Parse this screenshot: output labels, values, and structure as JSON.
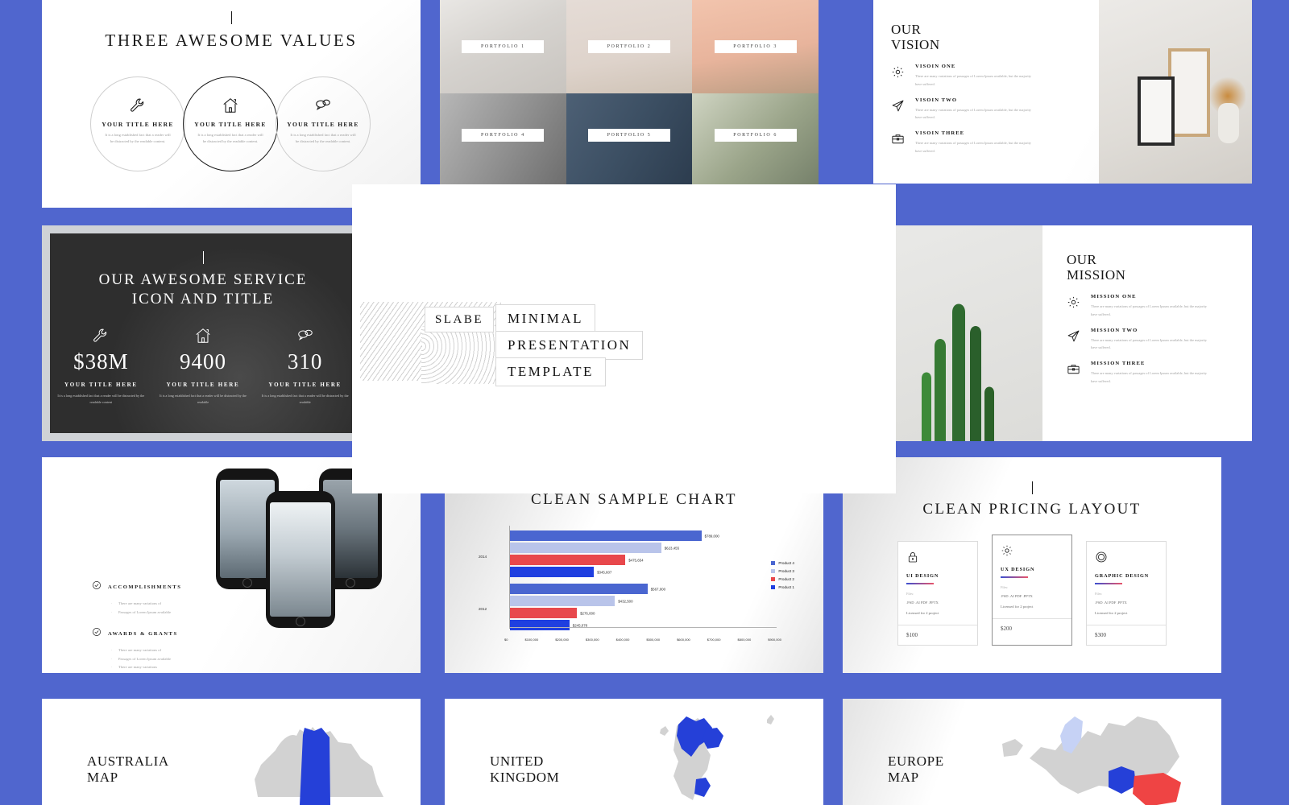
{
  "theme": {
    "background": "#5066ce",
    "accent_blue": "#2540d8",
    "accent_red": "#ef4444"
  },
  "overlay": {
    "brand": "SLABE",
    "line1": "MINIMAL",
    "line2": "PRESENTATION",
    "line3": "TEMPLATE"
  },
  "slide_values": {
    "title": "THREE AWESOME VALUES",
    "cards": [
      {
        "icon": "wrench-icon",
        "title": "YOUR TITLE HERE",
        "desc": "It is a long established fact that a reader will be distracted by the readable content."
      },
      {
        "icon": "home-icon",
        "title": "YOUR TITLE HERE",
        "desc": "It is a long established fact that a reader will be distracted by the readable content."
      },
      {
        "icon": "chat-icon",
        "title": "YOUR TITLE HERE",
        "desc": "It is a long established fact that a reader will be distracted by the readable content."
      }
    ]
  },
  "slide_portfolio": {
    "items": [
      {
        "caption": "PORTFOLIO 1"
      },
      {
        "caption": "PORTFOLIO 2"
      },
      {
        "caption": "PORTFOLIO 3"
      },
      {
        "caption": "PORTFOLIO 4"
      },
      {
        "caption": "PORTFOLIO 5"
      },
      {
        "caption": "PORTFOLIO 6"
      }
    ]
  },
  "slide_vision": {
    "title_line1": "OUR",
    "title_line2": "VISION",
    "items": [
      {
        "icon": "gear-icon",
        "heading": "VISOIN ONE",
        "desc": "There are many variations of passages of Lorem Ipsum available, but the majority have suffered."
      },
      {
        "icon": "paper-plane-icon",
        "heading": "VISOIN TWO",
        "desc": "There are many variations of passages of Lorem Ipsum available, but the majority have suffered."
      },
      {
        "icon": "briefcase-icon",
        "heading": "VISOIN THREE",
        "desc": "There are many variations of passages of Lorem Ipsum available, but the majority have suffered."
      }
    ]
  },
  "slide_service": {
    "title_line1": "OUR AWESOME SERVICE",
    "title_line2": "ICON AND TITLE",
    "columns": [
      {
        "icon": "wrench-icon",
        "number": "$38M",
        "title": "YOUR TITLE HERE",
        "desc": "It is a long established fact that a reader will be distracted by the readable content"
      },
      {
        "icon": "home-icon",
        "number": "9400",
        "title": "YOUR TITLE HERE",
        "desc": "It is a long established fact that a reader will be distracted by the readable"
      },
      {
        "icon": "chat-icon",
        "number": "310",
        "title": "YOUR TITLE HERE",
        "desc": "It is a long established fact that a reader will be distracted by the readable"
      }
    ]
  },
  "slide_mission": {
    "title_line1": "OUR",
    "title_line2": "MISSION",
    "items": [
      {
        "icon": "gear-icon",
        "heading": "MISSION ONE",
        "desc": "There are many variations of passages of Lorem Ipsum available, but the majority have suffered."
      },
      {
        "icon": "paper-plane-icon",
        "heading": "MISSION TWO",
        "desc": "There are many variations of passages of Lorem Ipsum available, but the majority have suffered."
      },
      {
        "icon": "briefcase-icon",
        "heading": "MISSION THREE",
        "desc": "There are many variations of passages of Lorem Ipsum available, but the majority have suffered."
      }
    ]
  },
  "slide_mobile": {
    "sections": [
      {
        "icon": "check-circle-icon",
        "heading": "ACCOMPLISHMENTS",
        "bullets": [
          "There are many variations of",
          "Passages of Lorem Ipsum available"
        ]
      },
      {
        "icon": "check-circle-icon",
        "heading": "AWARDS & GRANTS",
        "bullets": [
          "There are many variations of",
          "Passages of Lorem Ipsum available",
          "There are many variations"
        ]
      }
    ]
  },
  "slide_chart": {
    "title": "CLEAN SAMPLE CHART"
  },
  "chart_data": {
    "type": "bar",
    "orientation": "horizontal",
    "title": "CLEAN SAMPLE CHART",
    "categories": [
      "2014",
      "2012"
    ],
    "series": [
      {
        "name": "Product 4",
        "color": "#4a66d0",
        "values": [
          789000,
          567000
        ],
        "labels": [
          "$789,000",
          "$567,000"
        ]
      },
      {
        "name": "Product 3",
        "color": "#b9c4ea",
        "values": [
          623455,
          432500
        ],
        "labels": [
          "$623,455",
          "$432,500"
        ]
      },
      {
        "name": "Product 2",
        "color": "#e8484c",
        "values": [
          475654,
          276000
        ],
        "labels": [
          "$475,654",
          "$276,000"
        ]
      },
      {
        "name": "Product 1",
        "color": "#1f3fe0",
        "values": [
          345607,
          245078
        ],
        "labels": [
          "$345,607",
          "$245,078"
        ]
      }
    ],
    "xlabel": "",
    "ylabel": "",
    "xlim": [
      0,
      900000
    ],
    "xticks": [
      "$0",
      "$100,000",
      "$200,000",
      "$300,000",
      "$400,000",
      "$500,000",
      "$600,000",
      "$700,000",
      "$800,000",
      "$900,000"
    ],
    "grid": false,
    "legend_position": "right"
  },
  "slide_pricing": {
    "title": "CLEAN PRICING LAYOUT",
    "files_label": "Files:",
    "cards": [
      {
        "icon": "lock-icon",
        "name": "UI DESIGN",
        "files": ".PSD .AI PDF .PPTX",
        "license": "Licensed for 2 project",
        "price": "$100",
        "highlight": false
      },
      {
        "icon": "gear-icon",
        "name": "UX DESIGN",
        "files": ".PSD .AI PDF .PPTX",
        "license": "Licensed for 2 project",
        "price": "$200",
        "highlight": true
      },
      {
        "icon": "circles-icon",
        "name": "GRAPHIC DESIGN",
        "files": ".PSD .AI PDF .PPTX",
        "license": "Licensed for 2 project",
        "price": "$300",
        "highlight": false
      }
    ]
  },
  "slide_maps": [
    {
      "title_line1": "AUSTRALIA",
      "title_line2": "MAP"
    },
    {
      "title_line1": "UNITED",
      "title_line2": "KINGDOM"
    },
    {
      "title_line1": "EUROPE",
      "title_line2": "MAP"
    }
  ]
}
